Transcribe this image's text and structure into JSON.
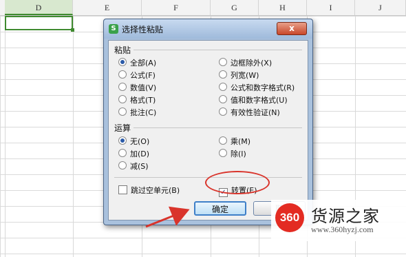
{
  "spreadsheet": {
    "columns": [
      "D",
      "E",
      "F",
      "G",
      "H",
      "I",
      "J"
    ]
  },
  "dialog": {
    "title": "选择性粘贴",
    "close_label": "x",
    "app_icon_label": "S",
    "paste_group": {
      "label": "粘贴",
      "options": [
        {
          "label": "全部(A)",
          "selected": true
        },
        {
          "label": "公式(F)",
          "selected": false
        },
        {
          "label": "数值(V)",
          "selected": false
        },
        {
          "label": "格式(T)",
          "selected": false
        },
        {
          "label": "批注(C)",
          "selected": false
        },
        {
          "label": "边框除外(X)",
          "selected": false
        },
        {
          "label": "列宽(W)",
          "selected": false
        },
        {
          "label": "公式和数字格式(R)",
          "selected": false
        },
        {
          "label": "值和数字格式(U)",
          "selected": false
        },
        {
          "label": "有效性验证(N)",
          "selected": false
        }
      ]
    },
    "operation_group": {
      "label": "运算",
      "options": [
        {
          "label": "无(O)",
          "selected": true
        },
        {
          "label": "加(D)",
          "selected": false
        },
        {
          "label": "减(S)",
          "selected": false
        },
        {
          "label": "乘(M)",
          "selected": false
        },
        {
          "label": "除(I)",
          "selected": false
        }
      ]
    },
    "skip_blanks": {
      "label": "跳过空单元(B)",
      "checked": false
    },
    "transpose": {
      "label": "转置(E)",
      "checked": true
    },
    "ok_label": "确定",
    "cancel_label": "取"
  },
  "watermark": {
    "logo_text": "360",
    "name": "货源之家",
    "url": "www.360hyzj.com"
  },
  "colors": {
    "active_cell_border": "#3f8a2f",
    "annotation_red": "#d9342b",
    "logo_red": "#e32b22"
  }
}
